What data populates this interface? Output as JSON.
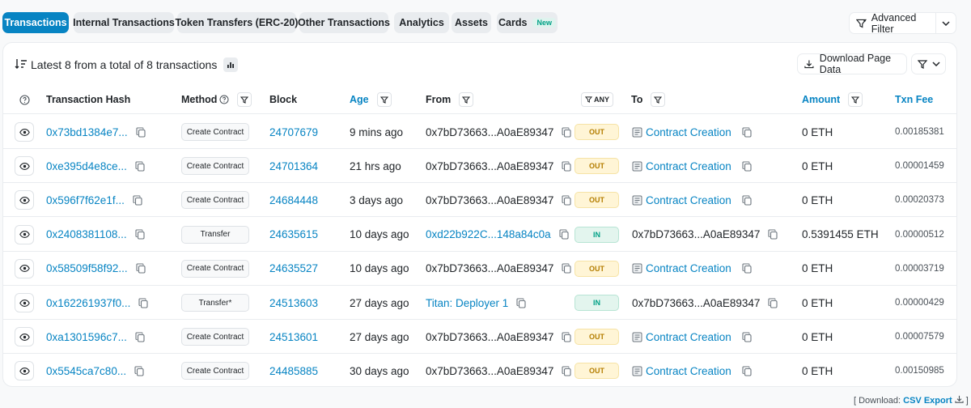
{
  "tabs": [
    {
      "label": "Transactions",
      "active": true
    },
    {
      "label": "Internal Transactions"
    },
    {
      "label": "Token Transfers (ERC-20)"
    },
    {
      "label": "Other Transactions"
    },
    {
      "label": "Analytics"
    },
    {
      "label": "Assets"
    },
    {
      "label": "Cards",
      "badge": "New"
    }
  ],
  "advanced_filter": {
    "label": "Advanced Filter"
  },
  "summary": {
    "text": "Latest 8 from a total of 8 transactions"
  },
  "download": {
    "label": "Download Page Data"
  },
  "columns": {
    "hash": "Transaction Hash",
    "method": "Method",
    "block": "Block",
    "age": "Age",
    "from": "From",
    "any": "ANY",
    "to": "To",
    "amount": "Amount",
    "fee": "Txn Fee"
  },
  "rows": [
    {
      "hash": "0x73bd1384e7...",
      "method": "Create Contract",
      "block": "24707679",
      "age": "9 mins ago",
      "from": "0x7bD73663...A0aE89347",
      "dir": "OUT",
      "to": "Contract Creation",
      "amount": "0 ETH",
      "fee": "0.00185381"
    },
    {
      "hash": "0xe395d4e8ce...",
      "method": "Create Contract",
      "block": "24701364",
      "age": "21 hrs ago",
      "from": "0x7bD73663...A0aE89347",
      "dir": "OUT",
      "to": "Contract Creation",
      "amount": "0 ETH",
      "fee": "0.00001459"
    },
    {
      "hash": "0x596f7f62e1f...",
      "method": "Create Contract",
      "block": "24684448",
      "age": "3 days ago",
      "from": "0x7bD73663...A0aE89347",
      "dir": "OUT",
      "to": "Contract Creation",
      "amount": "0 ETH",
      "fee": "0.00020373"
    },
    {
      "hash": "0x2408381108...",
      "method": "Transfer",
      "block": "24635615",
      "age": "10 days ago",
      "from": "0xd22b922C...148a84c0a",
      "dir": "IN",
      "to": "0x7bD73663...A0aE89347",
      "amount": "0.5391455 ETH",
      "fee": "0.00000512"
    },
    {
      "hash": "0x58509f58f92...",
      "method": "Create Contract",
      "block": "24635527",
      "age": "10 days ago",
      "from": "0x7bD73663...A0aE89347",
      "dir": "OUT",
      "to": "Contract Creation",
      "amount": "0 ETH",
      "fee": "0.00003719"
    },
    {
      "hash": "0x162261937f0...",
      "method": "Transfer*",
      "block": "24513603",
      "age": "27 days ago",
      "from": "Titan: Deployer 1",
      "dir": "IN",
      "to": "0x7bD73663...A0aE89347",
      "amount": "0 ETH",
      "fee": "0.00000429"
    },
    {
      "hash": "0xa1301596c7...",
      "method": "Create Contract",
      "block": "24513601",
      "age": "27 days ago",
      "from": "0x7bD73663...A0aE89347",
      "dir": "OUT",
      "to": "Contract Creation",
      "amount": "0 ETH",
      "fee": "0.00007579"
    },
    {
      "hash": "0x5545ca7c80...",
      "method": "Create Contract",
      "block": "24485885",
      "age": "30 days ago",
      "from": "0x7bD73663...A0aE89347",
      "dir": "OUT",
      "to": "Contract Creation",
      "amount": "0 ETH",
      "fee": "0.00150985"
    }
  ],
  "footer": {
    "prefix": "[ Download:",
    "link": "CSV Export",
    "suffix": "]"
  },
  "colors": {
    "accent": "#0784c3",
    "out_bg": "#fff5d6",
    "in_bg": "#e3f5ee"
  }
}
